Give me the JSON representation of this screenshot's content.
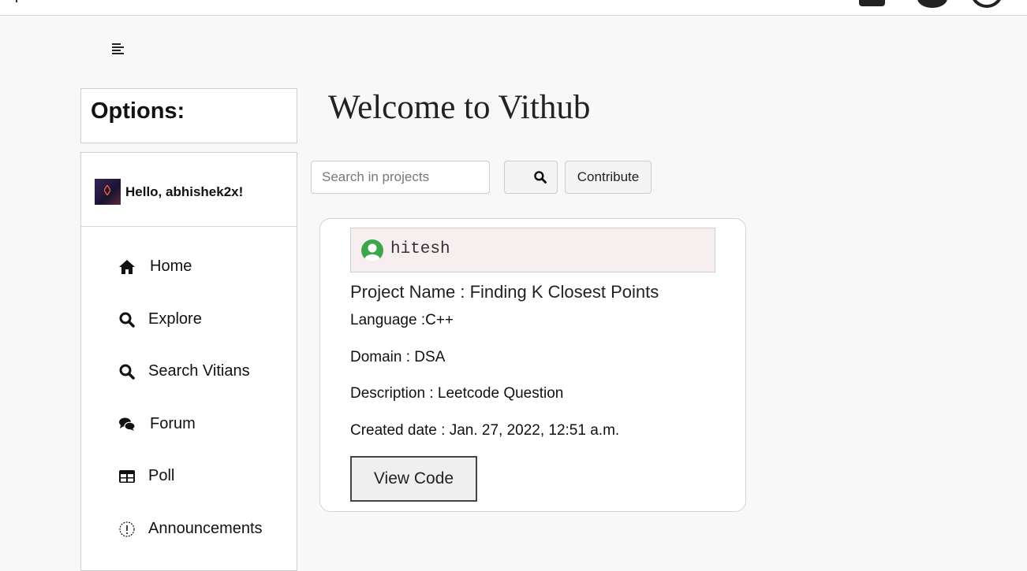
{
  "header": {
    "icons": [
      "box-icon",
      "gear-icon",
      "power-icon"
    ]
  },
  "sidebar": {
    "options_title": "Options:",
    "greeting": "Hello, abhishek2x!",
    "items": [
      {
        "label": "Home",
        "icon": "home-icon"
      },
      {
        "label": "Explore",
        "icon": "search-icon"
      },
      {
        "label": "Search Vitians",
        "icon": "search-icon"
      },
      {
        "label": "Forum",
        "icon": "comments-icon"
      },
      {
        "label": "Poll",
        "icon": "table-icon"
      },
      {
        "label": "Announcements",
        "icon": "info-circle-icon"
      }
    ]
  },
  "main": {
    "title": "Welcome to Vithub",
    "search": {
      "placeholder": "Search in projects",
      "value": ""
    },
    "contribute_label": "Contribute"
  },
  "project_card": {
    "username": "hitesh",
    "project_name": "Project Name : Finding K Closest Points",
    "language": "Language :C++",
    "domain": "Domain : DSA",
    "description": "Description : Leetcode Question",
    "created": "Created date : Jan. 27, 2022, 12:51 a.m.",
    "view_code_label": "View Code"
  },
  "colors": {
    "page_bg": "#f8f8f8",
    "card_header_bg": "#f7efef",
    "avatar_green": "#3fa650"
  }
}
